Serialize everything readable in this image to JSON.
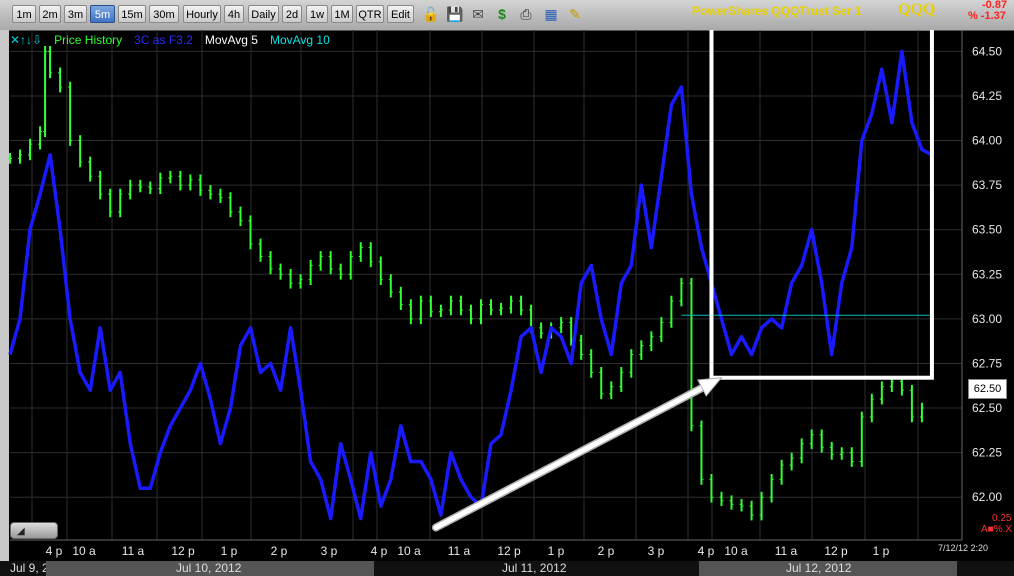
{
  "toolbar": {
    "timeframes": [
      {
        "label": "1m",
        "active": false
      },
      {
        "label": "2m",
        "active": false
      },
      {
        "label": "3m",
        "active": false
      },
      {
        "label": "5m",
        "active": true
      },
      {
        "label": "15m",
        "active": false
      },
      {
        "label": "30m",
        "active": false
      },
      {
        "label": "Hourly",
        "active": false
      },
      {
        "label": "4h",
        "active": false
      },
      {
        "label": "Daily",
        "active": false
      },
      {
        "label": "2d",
        "active": false
      },
      {
        "label": "1w",
        "active": false
      },
      {
        "label": "1M",
        "active": false
      },
      {
        "label": "QTR",
        "active": false
      },
      {
        "label": "Edit",
        "active": false
      }
    ],
    "icons": [
      "lock-icon",
      "save-icon",
      "mail-icon",
      "dollar-icon",
      "print-icon",
      "table-icon",
      "pencil-icon"
    ],
    "title": "PowerShares QQQTrust Ser 1",
    "ticker": "QQQ",
    "change_abs": "-0.87",
    "change_pct": "% -1.37"
  },
  "legend": {
    "prefix": "✕↑↓⇩",
    "items": [
      {
        "label": "Price History",
        "color": "#32ff32"
      },
      {
        "label": "3C as F3.2",
        "color": "#2a2aff"
      },
      {
        "label": "MovAvg 5",
        "color": "#ffffff"
      },
      {
        "label": "MovAvg 10",
        "color": "#00e5e5"
      }
    ]
  },
  "price_tag": "62.50",
  "minor_labels": [
    "0.25",
    "A■%.X"
  ],
  "timestamp": "7/12/12 2:20",
  "dates": [
    "Jul 9, 2",
    "Jul 10, 2012",
    "Jul 11, 2012",
    "Jul 12, 2012"
  ],
  "colors": {
    "price": "#32ff32",
    "osc": "#1a1aff",
    "ma10": "#00bcbc",
    "grid": "#2e2e2e",
    "box": "#ffffff",
    "arrow": "#ffffff"
  },
  "chart_data": {
    "type": "line",
    "x_tick_labels": [
      "4 p",
      "10 a",
      "11 a",
      "12 p",
      "1 p",
      "2 p",
      "3 p",
      "4 p",
      "10 a",
      "11 a",
      "12 p",
      "1 p",
      "2 p",
      "3 p",
      "4 p",
      "10 a",
      "11 a",
      "12 p",
      "1 p"
    ],
    "y_ticks": [
      62.0,
      62.25,
      62.5,
      62.75,
      63.0,
      63.25,
      63.5,
      63.75,
      64.0,
      64.25,
      64.5
    ],
    "ylim": [
      61.76,
      64.62
    ],
    "x_range": [
      0,
      190
    ],
    "grid": true,
    "series": [
      {
        "name": "Price History",
        "type": "bars",
        "points": [
          [
            0,
            63.9
          ],
          [
            2,
            63.92
          ],
          [
            4,
            63.98
          ],
          [
            6,
            64.05
          ],
          [
            7,
            64.5
          ],
          [
            8,
            64.38
          ],
          [
            10,
            64.3
          ],
          [
            12,
            64.0
          ],
          [
            14,
            63.88
          ],
          [
            16,
            63.8
          ],
          [
            18,
            63.7
          ],
          [
            20,
            63.6
          ],
          [
            22,
            63.7
          ],
          [
            24,
            63.75
          ],
          [
            26,
            63.74
          ],
          [
            28,
            63.73
          ],
          [
            30,
            63.79
          ],
          [
            32,
            63.8
          ],
          [
            34,
            63.75
          ],
          [
            36,
            63.78
          ],
          [
            38,
            63.72
          ],
          [
            40,
            63.7
          ],
          [
            42,
            63.68
          ],
          [
            44,
            63.6
          ],
          [
            46,
            63.55
          ],
          [
            48,
            63.42
          ],
          [
            50,
            63.35
          ],
          [
            52,
            63.28
          ],
          [
            54,
            63.25
          ],
          [
            56,
            63.2
          ],
          [
            58,
            63.22
          ],
          [
            60,
            63.3
          ],
          [
            62,
            63.35
          ],
          [
            64,
            63.28
          ],
          [
            66,
            63.25
          ],
          [
            68,
            63.35
          ],
          [
            70,
            63.4
          ],
          [
            72,
            63.32
          ],
          [
            74,
            63.22
          ],
          [
            76,
            63.15
          ],
          [
            78,
            63.08
          ],
          [
            80,
            63.0
          ],
          [
            82,
            63.1
          ],
          [
            84,
            63.04
          ],
          [
            86,
            63.05
          ],
          [
            88,
            63.1
          ],
          [
            90,
            63.05
          ],
          [
            92,
            63.0
          ],
          [
            94,
            63.08
          ],
          [
            96,
            63.05
          ],
          [
            98,
            63.06
          ],
          [
            100,
            63.1
          ],
          [
            102,
            63.05
          ],
          [
            104,
            62.95
          ],
          [
            106,
            62.92
          ],
          [
            108,
            62.95
          ],
          [
            110,
            62.98
          ],
          [
            112,
            62.88
          ],
          [
            114,
            62.8
          ],
          [
            116,
            62.7
          ],
          [
            118,
            62.58
          ],
          [
            120,
            62.62
          ],
          [
            122,
            62.7
          ],
          [
            124,
            62.8
          ],
          [
            126,
            62.85
          ],
          [
            128,
            62.9
          ],
          [
            130,
            62.98
          ],
          [
            132,
            63.1
          ],
          [
            134,
            63.2
          ],
          [
            136,
            62.4
          ],
          [
            138,
            62.1
          ],
          [
            140,
            62.0
          ],
          [
            142,
            61.98
          ],
          [
            144,
            61.96
          ],
          [
            146,
            61.95
          ],
          [
            148,
            61.9
          ],
          [
            150,
            62.0
          ],
          [
            152,
            62.1
          ],
          [
            154,
            62.18
          ],
          [
            156,
            62.22
          ],
          [
            158,
            62.3
          ],
          [
            160,
            62.35
          ],
          [
            162,
            62.28
          ],
          [
            164,
            62.24
          ],
          [
            166,
            62.25
          ],
          [
            168,
            62.2
          ],
          [
            170,
            62.45
          ],
          [
            172,
            62.55
          ],
          [
            174,
            62.62
          ],
          [
            176,
            62.65
          ],
          [
            178,
            62.6
          ],
          [
            180,
            62.45
          ],
          [
            182,
            62.5
          ]
        ]
      },
      {
        "name": "3C as F3.2",
        "type": "line",
        "points": [
          [
            0,
            62.8
          ],
          [
            2,
            63.0
          ],
          [
            4,
            63.5
          ],
          [
            6,
            63.7
          ],
          [
            8,
            63.92
          ],
          [
            10,
            63.5
          ],
          [
            12,
            63.0
          ],
          [
            14,
            62.7
          ],
          [
            16,
            62.6
          ],
          [
            18,
            62.95
          ],
          [
            20,
            62.6
          ],
          [
            22,
            62.7
          ],
          [
            24,
            62.3
          ],
          [
            26,
            62.05
          ],
          [
            28,
            62.05
          ],
          [
            30,
            62.25
          ],
          [
            32,
            62.4
          ],
          [
            34,
            62.5
          ],
          [
            36,
            62.6
          ],
          [
            38,
            62.75
          ],
          [
            40,
            62.55
          ],
          [
            42,
            62.3
          ],
          [
            44,
            62.5
          ],
          [
            46,
            62.85
          ],
          [
            48,
            62.95
          ],
          [
            50,
            62.7
          ],
          [
            52,
            62.75
          ],
          [
            54,
            62.6
          ],
          [
            56,
            62.95
          ],
          [
            58,
            62.6
          ],
          [
            60,
            62.2
          ],
          [
            62,
            62.1
          ],
          [
            64,
            61.88
          ],
          [
            66,
            62.3
          ],
          [
            68,
            62.1
          ],
          [
            70,
            61.88
          ],
          [
            72,
            62.25
          ],
          [
            74,
            61.95
          ],
          [
            76,
            62.1
          ],
          [
            78,
            62.4
          ],
          [
            80,
            62.2
          ],
          [
            82,
            62.2
          ],
          [
            84,
            62.1
          ],
          [
            86,
            61.9
          ],
          [
            88,
            62.25
          ],
          [
            90,
            62.1
          ],
          [
            92,
            62.0
          ],
          [
            94,
            61.95
          ],
          [
            96,
            62.3
          ],
          [
            98,
            62.35
          ],
          [
            100,
            62.6
          ],
          [
            102,
            62.9
          ],
          [
            104,
            62.95
          ],
          [
            106,
            62.7
          ],
          [
            108,
            62.95
          ],
          [
            110,
            62.9
          ],
          [
            112,
            62.75
          ],
          [
            114,
            63.2
          ],
          [
            116,
            63.3
          ],
          [
            118,
            63.0
          ],
          [
            120,
            62.8
          ],
          [
            122,
            63.2
          ],
          [
            124,
            63.3
          ],
          [
            126,
            63.75
          ],
          [
            128,
            63.4
          ],
          [
            130,
            63.8
          ],
          [
            132,
            64.2
          ],
          [
            134,
            64.3
          ],
          [
            136,
            63.7
          ],
          [
            138,
            63.4
          ],
          [
            140,
            63.2
          ],
          [
            142,
            63.0
          ],
          [
            144,
            62.8
          ],
          [
            146,
            62.9
          ],
          [
            148,
            62.8
          ],
          [
            150,
            62.95
          ],
          [
            152,
            63.0
          ],
          [
            154,
            62.95
          ],
          [
            156,
            63.2
          ],
          [
            158,
            63.3
          ],
          [
            160,
            63.5
          ],
          [
            162,
            63.2
          ],
          [
            164,
            62.8
          ],
          [
            166,
            63.2
          ],
          [
            168,
            63.4
          ],
          [
            170,
            64.0
          ],
          [
            172,
            64.15
          ],
          [
            174,
            64.4
          ],
          [
            176,
            64.1
          ],
          [
            178,
            64.5
          ],
          [
            180,
            64.1
          ],
          [
            182,
            63.95
          ],
          [
            184,
            63.92
          ]
        ]
      },
      {
        "name": "MovAvg 10",
        "type": "line",
        "points": [
          [
            134,
            63.02
          ],
          [
            184,
            63.02
          ]
        ]
      }
    ],
    "annotations": [
      {
        "type": "rectangle",
        "x": [
          140,
          184
        ],
        "y": [
          62.67,
          64.63
        ]
      },
      {
        "type": "arrow",
        "from": [
          85,
          61.83
        ],
        "to": [
          142,
          62.67
        ]
      }
    ]
  }
}
